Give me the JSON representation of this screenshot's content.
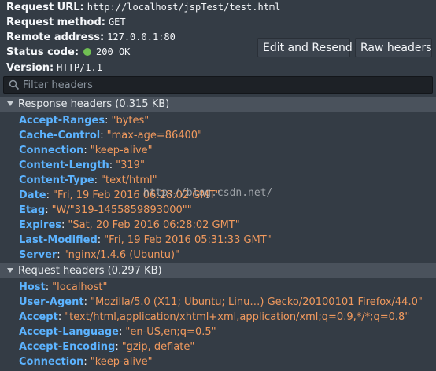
{
  "summary": {
    "request_url": {
      "label": "Request URL:",
      "value": "http://localhost/jspTest/test.html"
    },
    "request_method": {
      "label": "Request method:",
      "value": "GET"
    },
    "remote_address": {
      "label": "Remote address:",
      "value": "127.0.0.1:80"
    },
    "status_code": {
      "label": "Status code:",
      "value": "200 OK",
      "dot_color": "#70bf53"
    },
    "version": {
      "label": "Version:",
      "value": "HTTP/1.1"
    }
  },
  "toolbar": {
    "edit_resend_label": "Edit and Resend",
    "raw_headers_label": "Raw headers"
  },
  "filter": {
    "placeholder": "Filter headers",
    "value": ""
  },
  "response_headers": {
    "title": "Response headers (0.315 KB)",
    "items": [
      {
        "name": "Accept-Ranges",
        "value": "\"bytes\""
      },
      {
        "name": "Cache-Control",
        "value": "\"max-age=86400\""
      },
      {
        "name": "Connection",
        "value": "\"keep-alive\""
      },
      {
        "name": "Content-Length",
        "value": "\"319\""
      },
      {
        "name": "Content-Type",
        "value": "\"text/html\""
      },
      {
        "name": "Date",
        "value": "\"Fri, 19 Feb 2016 06:28:02 GMT\""
      },
      {
        "name": "Etag",
        "value": "\"W/\"319-1455859893000\"\""
      },
      {
        "name": "Expires",
        "value": "\"Sat, 20 Feb 2016 06:28:02 GMT\""
      },
      {
        "name": "Last-Modified",
        "value": "\"Fri, 19 Feb 2016 05:31:33 GMT\""
      },
      {
        "name": "Server",
        "value": "\"nginx/1.4.6 (Ubuntu)\""
      }
    ]
  },
  "request_headers": {
    "title": "Request headers (0.297 KB)",
    "items": [
      {
        "name": "Host",
        "value": "\"localhost\""
      },
      {
        "name": "User-Agent",
        "value": "\"Mozilla/5.0 (X11; Ubuntu; Linu…) Gecko/20100101 Firefox/44.0\""
      },
      {
        "name": "Accept",
        "value": "\"text/html,application/xhtml+xml,application/xml;q=0.9,*/*;q=0.8\""
      },
      {
        "name": "Accept-Language",
        "value": "\"en-US,en;q=0.5\""
      },
      {
        "name": "Accept-Encoding",
        "value": "\"gzip, deflate\""
      },
      {
        "name": "Connection",
        "value": "\"keep-alive\""
      }
    ]
  },
  "watermark": "http://blog.csdn.net/",
  "colors": {
    "background": "#343c45",
    "header_name": "#5cb3ff",
    "header_value": "#f29a5e",
    "group_bar": "#4a525c"
  }
}
